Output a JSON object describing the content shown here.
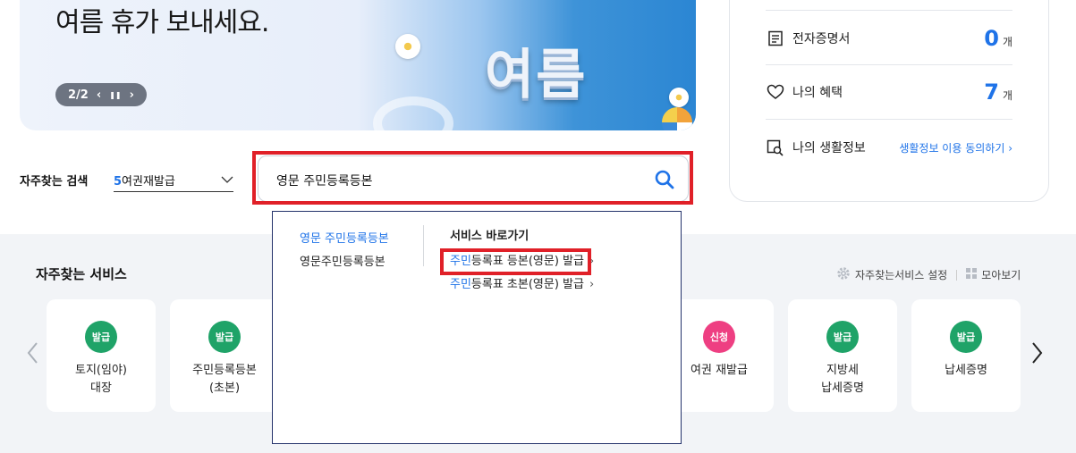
{
  "banner": {
    "headline": "여름 휴가 보내세요.",
    "art_text": "여름",
    "pager": {
      "current": "2/2",
      "prev": "‹",
      "pause": "❚❚",
      "next": "›"
    }
  },
  "info_card": {
    "items": [
      {
        "label": "전자증명서",
        "count": "0",
        "unit": "개",
        "icon": "document-list-icon"
      },
      {
        "label": "나의 혜택",
        "count": "7",
        "unit": "개",
        "icon": "heart-icon"
      },
      {
        "label": "나의 생활정보",
        "link": "생활정보 이용 동의하기",
        "icon": "search-document-icon"
      }
    ]
  },
  "search": {
    "faq_label": "자주찾는 검색",
    "faq_select": {
      "rank": "5",
      "value": "여권재발급"
    },
    "query": "영문 주민등록등본"
  },
  "autocomplete": {
    "suggestions": [
      "영문 주민등록등본",
      "영문주민등록등본"
    ],
    "shortcut_title": "서비스 바로가기",
    "shortcuts": [
      {
        "highlight": "주민",
        "rest": "등록표 등본(영문) 발급",
        "chev": "›"
      },
      {
        "highlight": "주민",
        "rest": "등록표 초본(영문) 발급",
        "chev": "›"
      }
    ]
  },
  "services": {
    "title": "자주찾는 서비스",
    "settings_label": "자주찾는서비스 설정",
    "view_all_label": "모아보기",
    "cards": [
      {
        "badge": "발급",
        "badge_color": "#1fa368",
        "label": "토지(임야)\n대장"
      },
      {
        "badge": "발급",
        "badge_color": "#1fa368",
        "label": "주민등록등본\n(초본)"
      },
      {
        "badge": "신청",
        "badge_color": "#ee3f82",
        "label": "여권 재발급"
      },
      {
        "badge": "발급",
        "badge_color": "#1fa368",
        "label": "지방세\n납세증명"
      },
      {
        "badge": "발급",
        "badge_color": "#1fa368",
        "label": "납세증명"
      }
    ]
  },
  "colors": {
    "accent": "#1f73e8",
    "highlight_box": "#e02028",
    "issue_green": "#1fa368",
    "apply_pink": "#ee3f82"
  }
}
